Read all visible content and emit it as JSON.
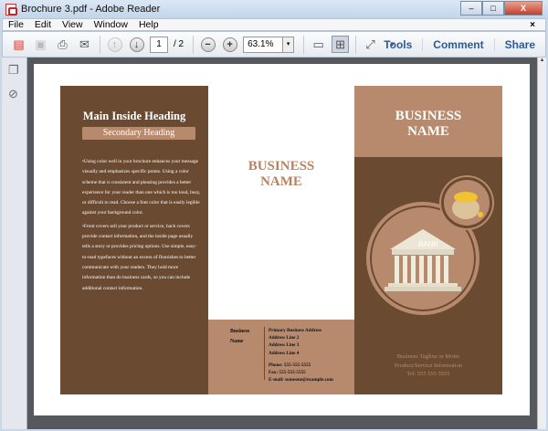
{
  "window": {
    "title": "Brochure 3.pdf - Adobe Reader",
    "min": "–",
    "max": "□",
    "close": "X"
  },
  "menu": [
    "File",
    "Edit",
    "View",
    "Window",
    "Help"
  ],
  "menu_close": "×",
  "toolbar": {
    "page_current": "1",
    "page_total": "/ 2",
    "zoom": "63.1%",
    "zoom_caret": "▾",
    "more": "▾",
    "links": [
      "Tools",
      "Comment",
      "Share"
    ]
  },
  "brochure": {
    "main_heading": "Main Inside Heading",
    "secondary_heading": "Secondary Heading",
    "paragraphs": [
      "•Using color well in your brochure enhances your message visually and emphasizes specific points. Using a color scheme that is consistent and pleasing provides a better experience for your reader than one which is too loud, busy, or difficult to read. Choose a font color that is easily legible against your background color.",
      "•Front covers sell your product or service, back covers provide contact information, and the inside page usually tells a story or provides pricing options. Use simple, easy-to-read typefaces without an excess of flourishes to better communicate with your readers. They hold more information than do business cards, so you can include additional contact information."
    ],
    "middle_name_line1": "BUSINESS",
    "middle_name_line2": "NAME",
    "contact_name_line1": "Business",
    "contact_name_line2": "Name",
    "address": [
      "Primary Business Address",
      "Address Line 2",
      "Address Line 3",
      "Address Line 4"
    ],
    "phone": "Phone: 555-555-5555",
    "fax": "Fax: 555-555-5555",
    "email": "E-mail: someone@example.com",
    "cover_name_line1": "BUSINESS",
    "cover_name_line2": "NAME",
    "bank_label": "BANK",
    "tagline": "Business Tagline or Motto",
    "product": "Product/Service Information",
    "tel": "Tel: 555 555 5555"
  }
}
